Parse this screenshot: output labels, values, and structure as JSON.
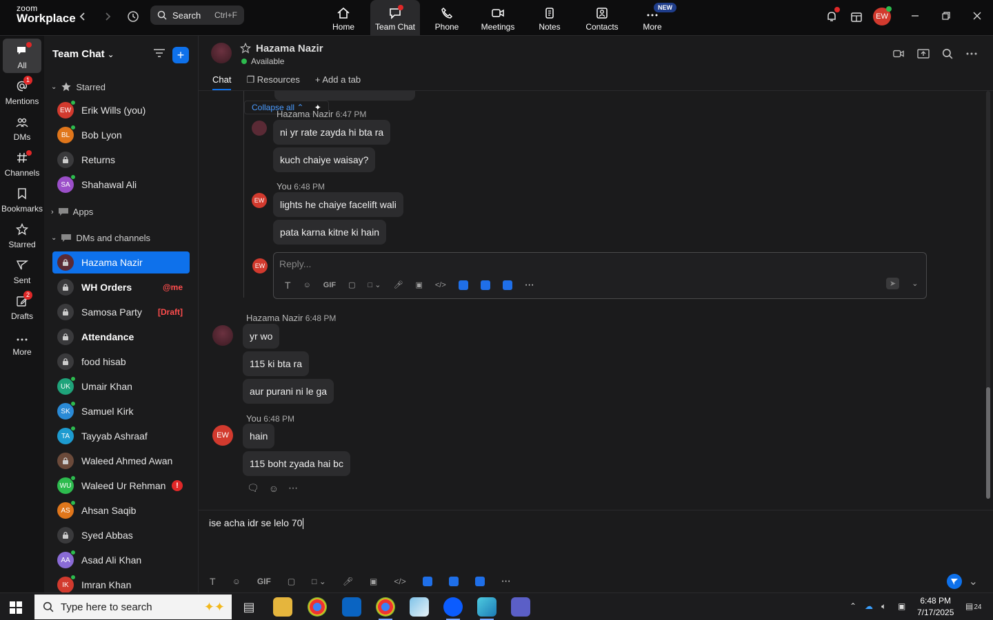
{
  "app": {
    "logo_line1": "zoom",
    "logo_line2": "Workplace"
  },
  "search": {
    "label": "Search",
    "shortcut": "Ctrl+F"
  },
  "nav": [
    {
      "label": "Home"
    },
    {
      "label": "Team Chat"
    },
    {
      "label": "Phone"
    },
    {
      "label": "Meetings"
    },
    {
      "label": "Notes"
    },
    {
      "label": "Contacts"
    },
    {
      "label": "More"
    }
  ],
  "nav_new_badge": "NEW",
  "user_initials": "EW",
  "rail": [
    {
      "label": "All"
    },
    {
      "label": "Mentions",
      "badge": "1"
    },
    {
      "label": "DMs"
    },
    {
      "label": "Channels"
    },
    {
      "label": "Bookmarks"
    },
    {
      "label": "Starred"
    },
    {
      "label": "Sent"
    },
    {
      "label": "Drafts",
      "badge": "2"
    },
    {
      "label": "More"
    }
  ],
  "list": {
    "title": "Team Chat",
    "starred_label": "Starred",
    "apps_label": "Apps",
    "dms_label": "DMs and channels",
    "starred": [
      {
        "name": "Erik Wills (you)",
        "initials": "EW",
        "color": "#d23a2e"
      },
      {
        "name": "Bob Lyon",
        "initials": "BL",
        "color": "#e0761b"
      },
      {
        "name": "Returns",
        "initials": "",
        "color": "#3a3a3c"
      },
      {
        "name": "Shahawal Ali",
        "initials": "SA",
        "color": "#9b4fc9"
      }
    ],
    "dms": [
      {
        "name": "Hazama Nazir",
        "initials": "",
        "color": "#5a2a35"
      },
      {
        "name": "WH Orders",
        "initials": "",
        "color": "#3a3a3c",
        "tag": "@me"
      },
      {
        "name": "Samosa Party",
        "initials": "",
        "color": "#3a3a3c",
        "tag": "[Draft]"
      },
      {
        "name": "Attendance",
        "initials": "",
        "color": "#3a3a3c"
      },
      {
        "name": "food hisab",
        "initials": "",
        "color": "#3a3a3c"
      },
      {
        "name": "Umair Khan",
        "initials": "UK",
        "color": "#1fa37a"
      },
      {
        "name": "Samuel Kirk",
        "initials": "SK",
        "color": "#2a8ad6"
      },
      {
        "name": "Tayyab Ashraaf",
        "initials": "TA",
        "color": "#1d9bd0"
      },
      {
        "name": "Waleed Ahmed Awan",
        "initials": "",
        "color": "#6b4a3a"
      },
      {
        "name": "Waleed Ur Rehman",
        "initials": "WU",
        "color": "#2dbb4e",
        "warn": "!"
      },
      {
        "name": "Ahsan Saqib",
        "initials": "AS",
        "color": "#e0761b"
      },
      {
        "name": "Syed Abbas",
        "initials": "",
        "color": "#3a3a3c"
      },
      {
        "name": "Asad Ali Khan",
        "initials": "AA",
        "color": "#8a6bd6"
      },
      {
        "name": "Imran Khan",
        "initials": "IK",
        "color": "#d23a2e"
      }
    ]
  },
  "conversation": {
    "name": "Hazama Nazir",
    "status": "Available",
    "tabs": [
      "Chat",
      "Resources",
      "Add a tab"
    ],
    "thread": {
      "collapse_label": "Collapse all",
      "msg1_meta_name": "Hazama Nazir",
      "msg1_meta_time": "6:47 PM",
      "msg1_a": "ni yr rate zayda hi bta ra",
      "msg1_b": "kuch chaiye waisay?",
      "msg2_meta_name": "You",
      "msg2_meta_time": "6:48 PM",
      "msg2_a": "lights he chaiye facelift wali",
      "msg2_b": "pata karna kitne ki hain",
      "reply_placeholder": "Reply..."
    },
    "messages": {
      "h_name": "Hazama Nazir",
      "h_time": "6:48 PM",
      "h1": "yr wo",
      "h2": "115 ki bta ra",
      "h3": "aur purani ni le ga",
      "y_name": "You",
      "y_time": "6:48 PM",
      "y1": "hain",
      "y2": "115 boht zyada hai bc"
    },
    "composer_text": "ise acha idr se lelo 70",
    "gif_label": "GIF"
  },
  "taskbar": {
    "search_placeholder": "Type here to search",
    "time": "6:48 PM",
    "date": "7/17/2025",
    "notif_count": "24"
  }
}
